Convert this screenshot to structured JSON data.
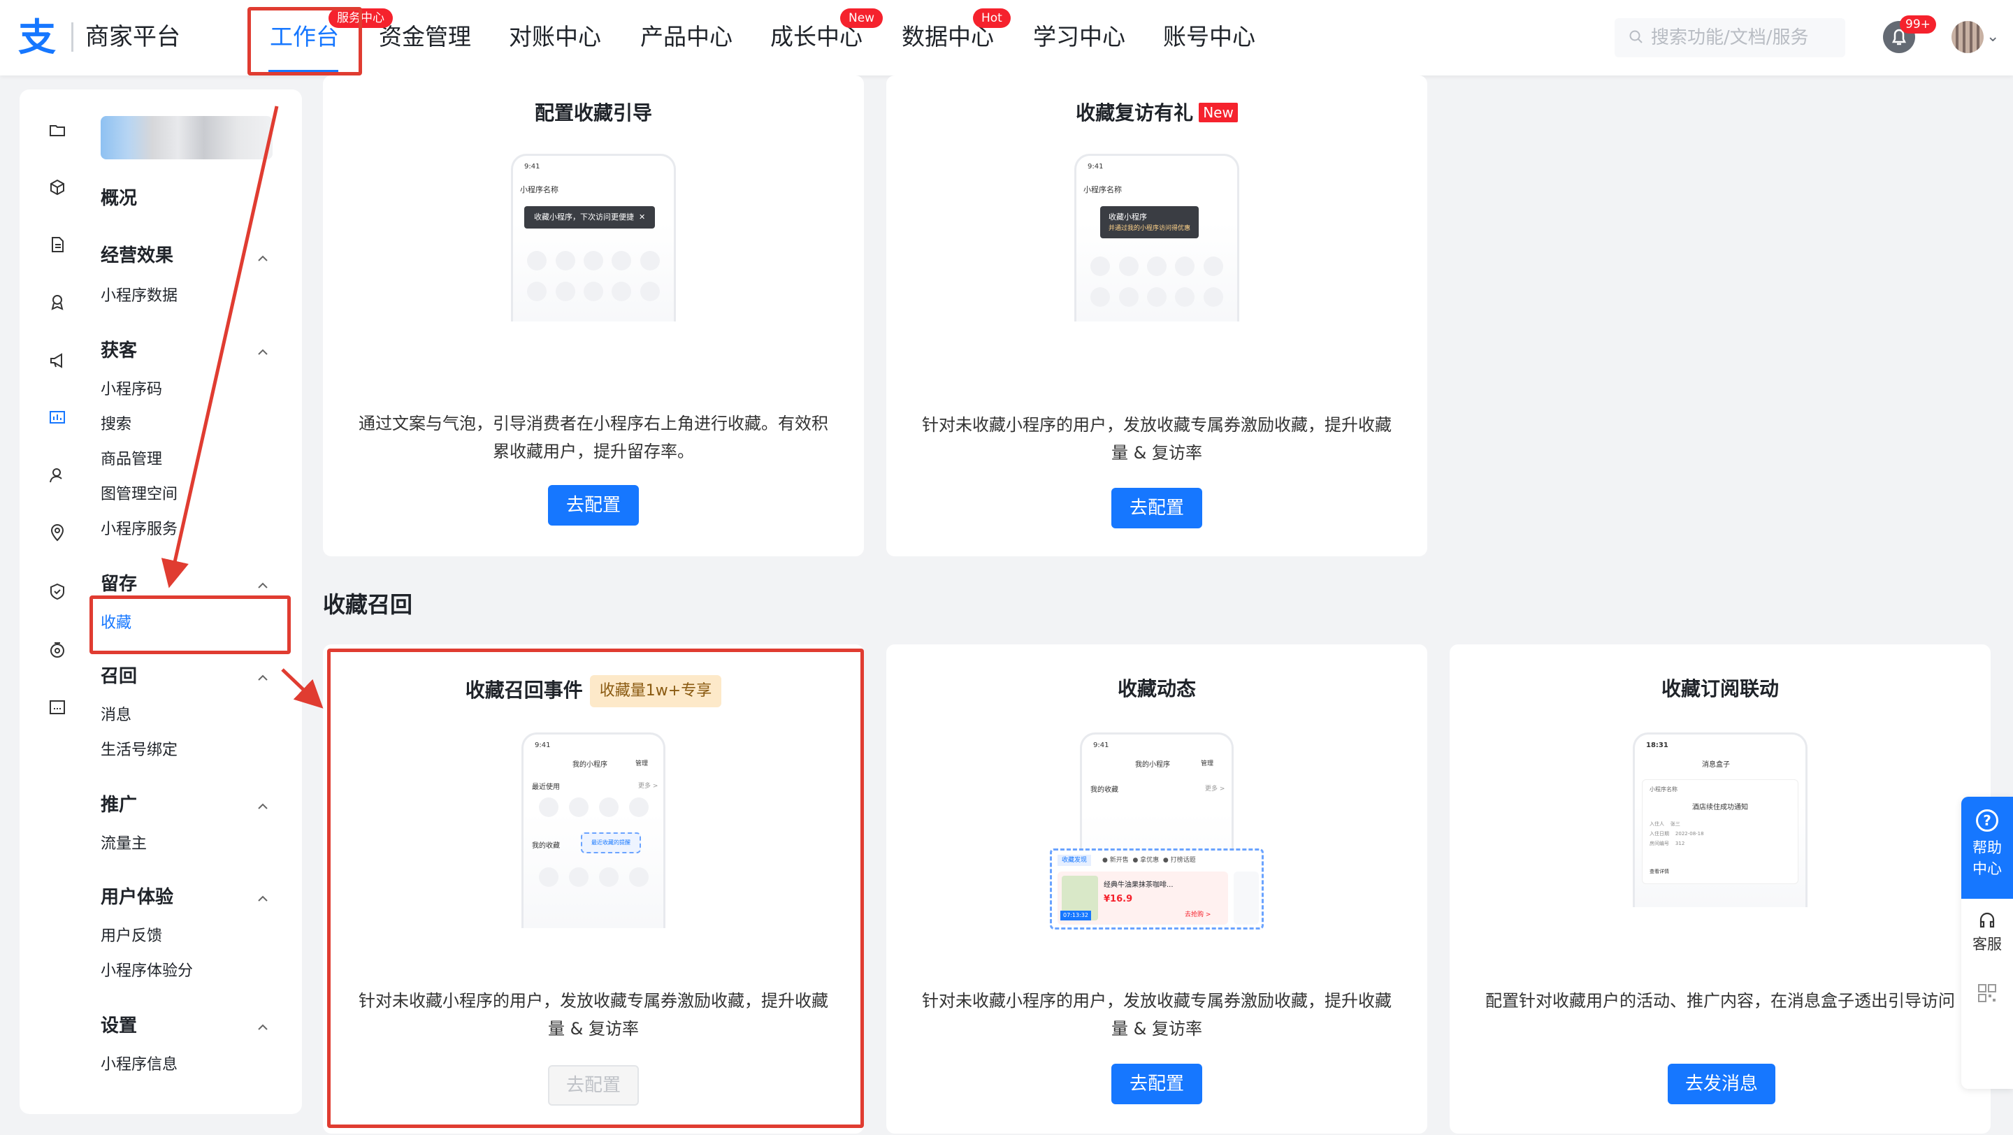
{
  "header": {
    "brand": "商家平台",
    "nav": [
      "工作台",
      "资金管理",
      "对账中心",
      "产品中心",
      "成长中心",
      "数据中心",
      "学习中心",
      "账号中心"
    ],
    "active_nav": "工作台",
    "badges": {
      "workbench": "服务中心",
      "growth": "New",
      "data": "Hot"
    },
    "search_placeholder": "搜索功能/文档/服务",
    "notification_count": "99+"
  },
  "sidebar": {
    "overview": "概况",
    "groups": [
      {
        "title": "经营效果",
        "items": [
          "小程序数据"
        ]
      },
      {
        "title": "获客",
        "items": [
          "小程序码",
          "搜索",
          "商品管理",
          "图管理空间",
          "小程序服务"
        ]
      },
      {
        "title": "留存",
        "items": [
          "收藏"
        ]
      },
      {
        "title": "召回",
        "items": [
          "消息",
          "生活号绑定"
        ]
      },
      {
        "title": "推广",
        "items": [
          "流量主"
        ]
      },
      {
        "title": "用户体验",
        "items": [
          "用户反馈",
          "小程序体验分"
        ]
      },
      {
        "title": "设置",
        "items": [
          "小程序信息"
        ]
      }
    ],
    "active_item": "收藏"
  },
  "cards_top": [
    {
      "title": "配置收藏引导",
      "desc": "通过文案与气泡，引导消费者在小程序右上角进行收藏。有效积累收藏用户，提升留存率。",
      "button": "去配置",
      "phone": {
        "time": "9:41",
        "name": "小程序名称",
        "tip": "收藏小程序，下次访问更便捷"
      }
    },
    {
      "title": "收藏复访有礼",
      "tag": "New",
      "desc": "针对未收藏小程序的用户，发放收藏专属券激励收藏，提升收藏量 & 复访率",
      "button": "去配置",
      "phone": {
        "time": "9:41",
        "name": "小程序名称",
        "tip": "收藏小程序",
        "tip2": "并通过我的小程序访问得优惠"
      }
    }
  ],
  "section_title": "收藏召回",
  "cards_bottom": [
    {
      "title": "收藏召回事件",
      "tag": "收藏量1w+专享",
      "desc": "针对未收藏小程序的用户，发放收藏专属券激励收藏，提升收藏量 & 复访率",
      "button": "去配置",
      "disabled": true,
      "phone": {
        "time": "9:41",
        "header": "我的小程序",
        "manage": "管理",
        "recent": "最近使用",
        "more": "更多 >",
        "fav": "我的收藏",
        "fav_tip": "最近收藏的提醒"
      }
    },
    {
      "title": "收藏动态",
      "desc": "针对未收藏小程序的用户，发放收藏专属券激励收藏，提升收藏量 & 复访率",
      "button": "去配置",
      "phone": {
        "time": "9:41",
        "header": "我的小程序",
        "manage": "管理",
        "fav": "我的收藏",
        "more": "更多 >",
        "feed_title": "收藏发现",
        "feed_tags": [
          "新开售",
          "拿优惠",
          "打榜话题"
        ],
        "product": "经典牛油果抹茶咖啡...",
        "price": "¥16.9",
        "countdown": "07:13:32",
        "buy": "去抢购 >"
      }
    },
    {
      "title": "收藏订阅联动",
      "desc": "配置针对收藏用户的活动、推广内容，在消息盒子透出引导访问",
      "button": "去发消息",
      "phone": {
        "time": "18:31",
        "header": "消息盒子",
        "app": "小程序名称",
        "msg": "酒店续住成功通知",
        "rows": [
          [
            "入住人",
            "张三"
          ],
          [
            "入住日期",
            "2022-08-18"
          ],
          [
            "房间编号",
            "312"
          ]
        ],
        "link": "查看详情"
      }
    }
  ],
  "help": {
    "label1": "帮助",
    "label2": "中心",
    "service": "客服"
  },
  "colors": {
    "accent": "#1677ff",
    "danger": "#f5222d",
    "annotation": "#e03c31"
  }
}
